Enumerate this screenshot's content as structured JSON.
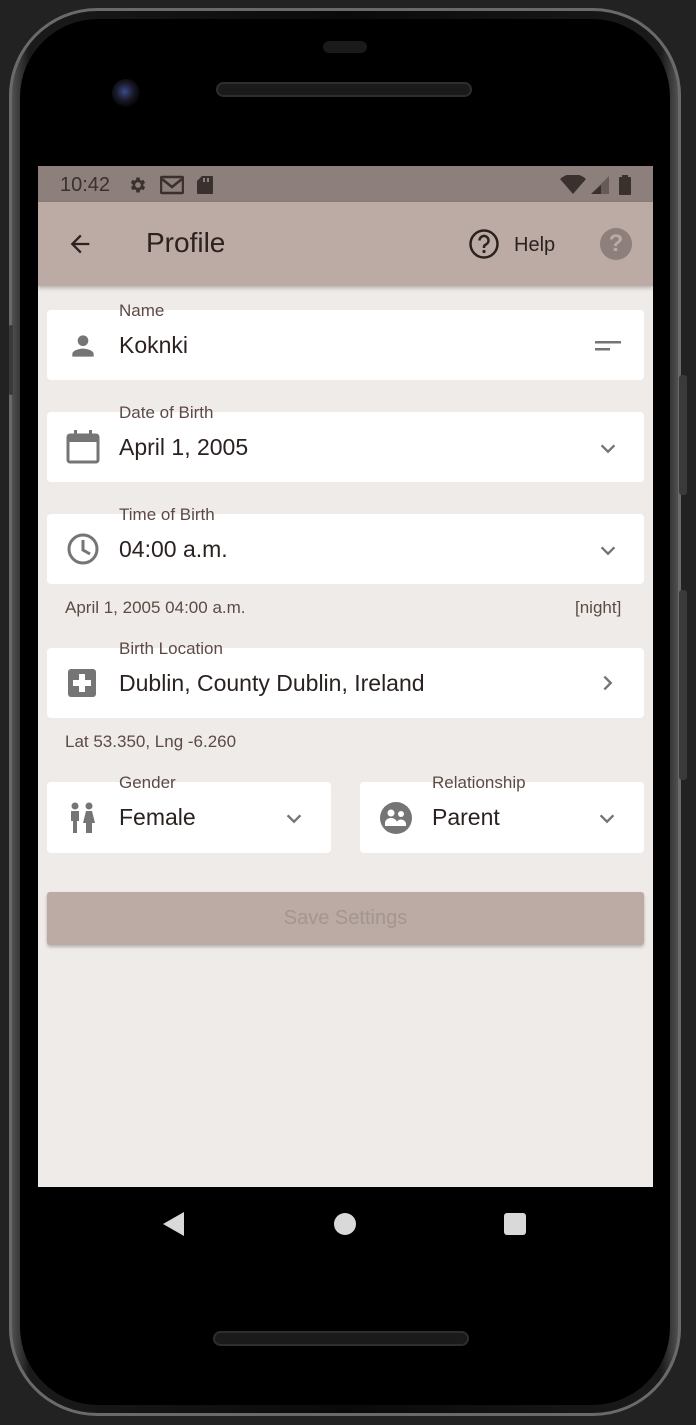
{
  "status_bar": {
    "time": "10:42",
    "icons": [
      "gear-icon",
      "gmail-icon",
      "sd-card-icon",
      "wifi-icon",
      "signal-icon",
      "battery-icon"
    ]
  },
  "appbar": {
    "title": "Profile",
    "help_label": "Help",
    "help_glyph": "?"
  },
  "form": {
    "name": {
      "label": "Name",
      "value": "Koknki"
    },
    "date_of_birth": {
      "label": "Date of Birth",
      "value": "April 1, 2005"
    },
    "time_of_birth": {
      "label": "Time of Birth",
      "value": "04:00 a.m."
    },
    "datetime_summary": "April 1, 2005 04:00 a.m.",
    "period": "[night]",
    "birth_location": {
      "label": "Birth Location",
      "value": "Dublin, County Dublin, Ireland"
    },
    "coordinates": "Lat 53.350, Lng -6.260",
    "gender": {
      "label": "Gender",
      "value": "Female"
    },
    "relationship": {
      "label": "Relationship",
      "value": "Parent"
    },
    "save_label": "Save Settings"
  },
  "colors": {
    "appbar": "#bcaaa4",
    "statusbar": "#8d7f7b",
    "background": "#efebe9",
    "icon": "#757575",
    "text": "#2b2220",
    "label": "#5d4a45"
  }
}
